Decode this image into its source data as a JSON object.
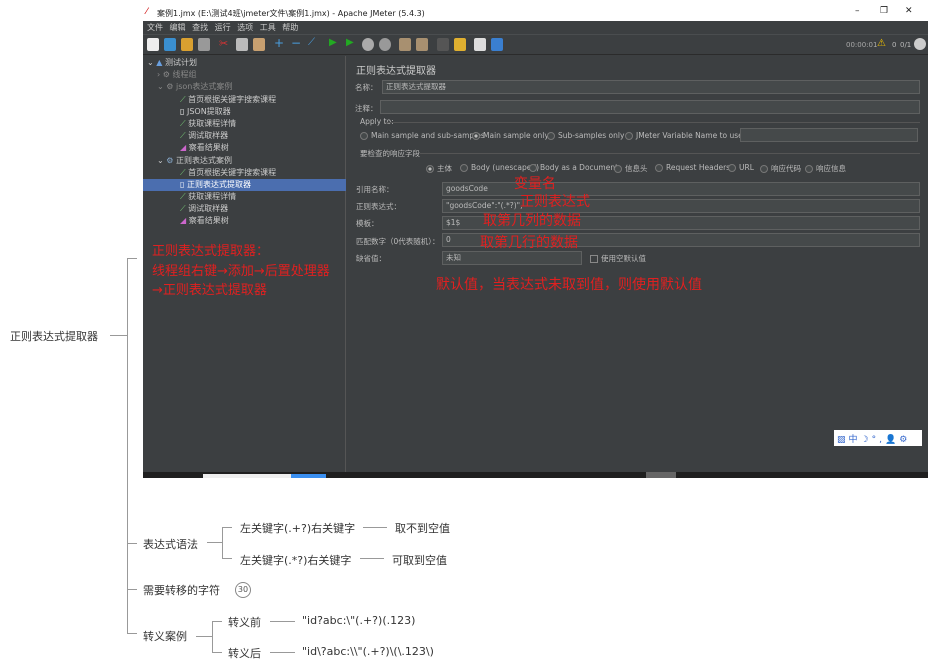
{
  "window": {
    "title": "案例1.jmx (E:\\测试4班\\jmeter文件\\案例1.jmx) - Apache JMeter (5.4.3)",
    "controls": [
      "–",
      "❐",
      "✕"
    ],
    "menu": [
      "文件",
      "编辑",
      "查找",
      "运行",
      "选项",
      "工具",
      "帮助"
    ],
    "status": {
      "timer": "00:00:01",
      "warnings": "0",
      "threads": "0/1"
    }
  },
  "tree": [
    {
      "label": "测试计划",
      "level": 0
    },
    {
      "label": "线程组",
      "level": 1,
      "disabled": true
    },
    {
      "label": "json表达式案例",
      "level": 1,
      "disabled": true
    },
    {
      "label": "首页根据关键字搜索课程",
      "level": 2
    },
    {
      "label": "JSON提取器",
      "level": 2
    },
    {
      "label": "获取课程详情",
      "level": 2
    },
    {
      "label": "调试取样器",
      "level": 2
    },
    {
      "label": "察看结果树",
      "level": 2
    },
    {
      "label": "正则表达式案例",
      "level": 1
    },
    {
      "label": "首页根据关键字搜索课程",
      "level": 2
    },
    {
      "label": "正则表达式提取器",
      "level": 2,
      "selected": true
    },
    {
      "label": "获取课程详情",
      "level": 2
    },
    {
      "label": "调试取样器",
      "level": 2
    },
    {
      "label": "察看结果树",
      "level": 2
    }
  ],
  "form": {
    "title": "正则表达式提取器",
    "name_label": "名称：",
    "name_value": "正则表达式提取器",
    "comment_label": "注释：",
    "comment_value": "",
    "apply_to": "Apply to:",
    "apply_options": [
      "Main sample and sub-samples",
      "Main sample only",
      "Sub-samples only",
      "JMeter Variable Name to use"
    ],
    "apply_selected": "Main sample only",
    "field_label": "要检查的响应字段",
    "field_options": [
      "主体",
      "Body (unescaped)",
      "Body as a Document",
      "信息头",
      "Request Headers",
      "URL",
      "响应代码",
      "响应信息"
    ],
    "field_selected": "主体",
    "ref_label": "引用名称：",
    "ref_value": "goodsCode",
    "regex_label": "正则表达式：",
    "regex_value": "\"goodsCode\":\"(.*?)\",",
    "template_label": "模板：",
    "template_value": "$1$",
    "match_label": "匹配数字（0代表随机）：",
    "match_value": "0",
    "default_label": "缺省值：",
    "default_value": "未知",
    "empty_default_label": "使用空默认值",
    "empty_default_checked": false
  },
  "annotations": {
    "left": [
      "正则表达式提取器：",
      "线程组右键→添加→后置处理器",
      "→正则表达式提取器"
    ],
    "var": "变量名",
    "regex": "正则表达式",
    "col": "取第几列的数据",
    "row": "取第几行的数据",
    "default": "默认值，当表达式未取到值，则使用默认值"
  },
  "ime": [
    "中",
    "☽",
    "°,",
    "👤",
    "⚙"
  ],
  "mindmap": {
    "root": "正则表达式提取器",
    "syntax": {
      "label": "表达式语法",
      "items": [
        {
          "pattern": "左关键字(.+?)右关键字",
          "note": "取不到空值"
        },
        {
          "pattern": "左关键字(.*?)右关键字",
          "note": "可取到空值"
        }
      ]
    },
    "escape_chars": {
      "label": "需要转移的字符",
      "badge": "30"
    },
    "escape_case": {
      "label": "转义案例",
      "items": [
        {
          "label": "转义前",
          "value": "\"id?abc:\\\"(.+?)(.123)"
        },
        {
          "label": "转义后",
          "value": "\"id\\?abc:\\\\\"(.+?)\\(\\.123\\)"
        }
      ]
    }
  }
}
